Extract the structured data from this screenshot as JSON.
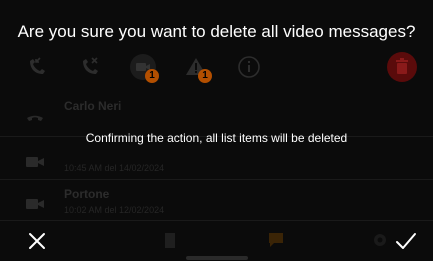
{
  "dialog": {
    "title": "Are you sure you want to delete all video messages?",
    "message": "Confirming the action, all list items will be deleted",
    "cancel_icon": "close-icon",
    "confirm_icon": "checkmark-icon"
  },
  "toolbar": {
    "items": [
      {
        "icon": "call-incoming-icon"
      },
      {
        "icon": "call-missed-icon"
      },
      {
        "icon": "video-message-icon",
        "badge": "1"
      },
      {
        "icon": "alert-icon",
        "badge": "1"
      },
      {
        "icon": "info-icon"
      },
      {
        "icon": "trash-icon"
      }
    ]
  },
  "list": {
    "items": [
      {
        "icon": "handset-icon",
        "name": "Carlo Neri",
        "date": ""
      },
      {
        "icon": "video-icon",
        "name": "",
        "date": "10:45 AM del 14/02/2024"
      },
      {
        "icon": "video-icon",
        "name": "Portone",
        "date": "10:02 AM del 12/02/2024"
      }
    ]
  },
  "bottom_bar": {
    "items": [
      {
        "icon": "door-icon"
      },
      {
        "icon": "message-icon"
      },
      {
        "icon": "settings-icon"
      }
    ]
  },
  "colors": {
    "background": "#000000",
    "accent_orange": "#b34f00",
    "trash_red": "#5a0b0b",
    "dialog_text": "#ffffff"
  }
}
